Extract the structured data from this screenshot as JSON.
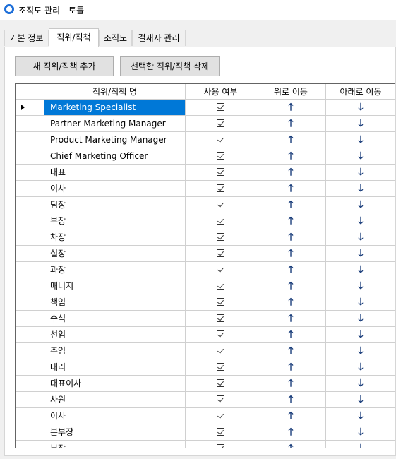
{
  "window": {
    "title": "조직도 관리 - 토틀"
  },
  "tabs": [
    {
      "label": "기본 정보",
      "active": false
    },
    {
      "label": "직위/직책",
      "active": true
    },
    {
      "label": "조직도",
      "active": false
    },
    {
      "label": "결재자 관리",
      "active": false
    }
  ],
  "toolbar": {
    "add_label": "새 직위/직책 추가",
    "delete_label": "선택한 직위/직책 삭제"
  },
  "grid": {
    "columns": [
      "직위/직책 명",
      "사용 여부",
      "위로 이동",
      "아래로 이동"
    ],
    "icons": {
      "up": "arrow-up-icon",
      "down": "arrow-down-icon",
      "checkbox": "checked-checkbox"
    },
    "selected_row": 0,
    "rows": [
      {
        "name": "Marketing Specialist",
        "used": true
      },
      {
        "name": "Partner Marketing Manager",
        "used": true
      },
      {
        "name": "Product Marketing Manager",
        "used": true
      },
      {
        "name": "Chief Marketing Officer",
        "used": true
      },
      {
        "name": "대표",
        "used": true
      },
      {
        "name": "이사",
        "used": true
      },
      {
        "name": "팀장",
        "used": true
      },
      {
        "name": "부장",
        "used": true
      },
      {
        "name": "차장",
        "used": true
      },
      {
        "name": "실장",
        "used": true
      },
      {
        "name": "과장",
        "used": true
      },
      {
        "name": "매니저",
        "used": true
      },
      {
        "name": "책임",
        "used": true
      },
      {
        "name": "수석",
        "used": true
      },
      {
        "name": "선임",
        "used": true
      },
      {
        "name": "주임",
        "used": true
      },
      {
        "name": "대리",
        "used": true
      },
      {
        "name": "대표이사",
        "used": true
      },
      {
        "name": "사원",
        "used": true
      },
      {
        "name": "이사",
        "used": true
      },
      {
        "name": "본부장",
        "used": true
      },
      {
        "name": "부장",
        "used": true
      }
    ]
  },
  "glyphs": {
    "up": "🡑",
    "down": "🡓"
  },
  "colors": {
    "selection": "#0078d7",
    "accent": "#1e6fd9"
  }
}
